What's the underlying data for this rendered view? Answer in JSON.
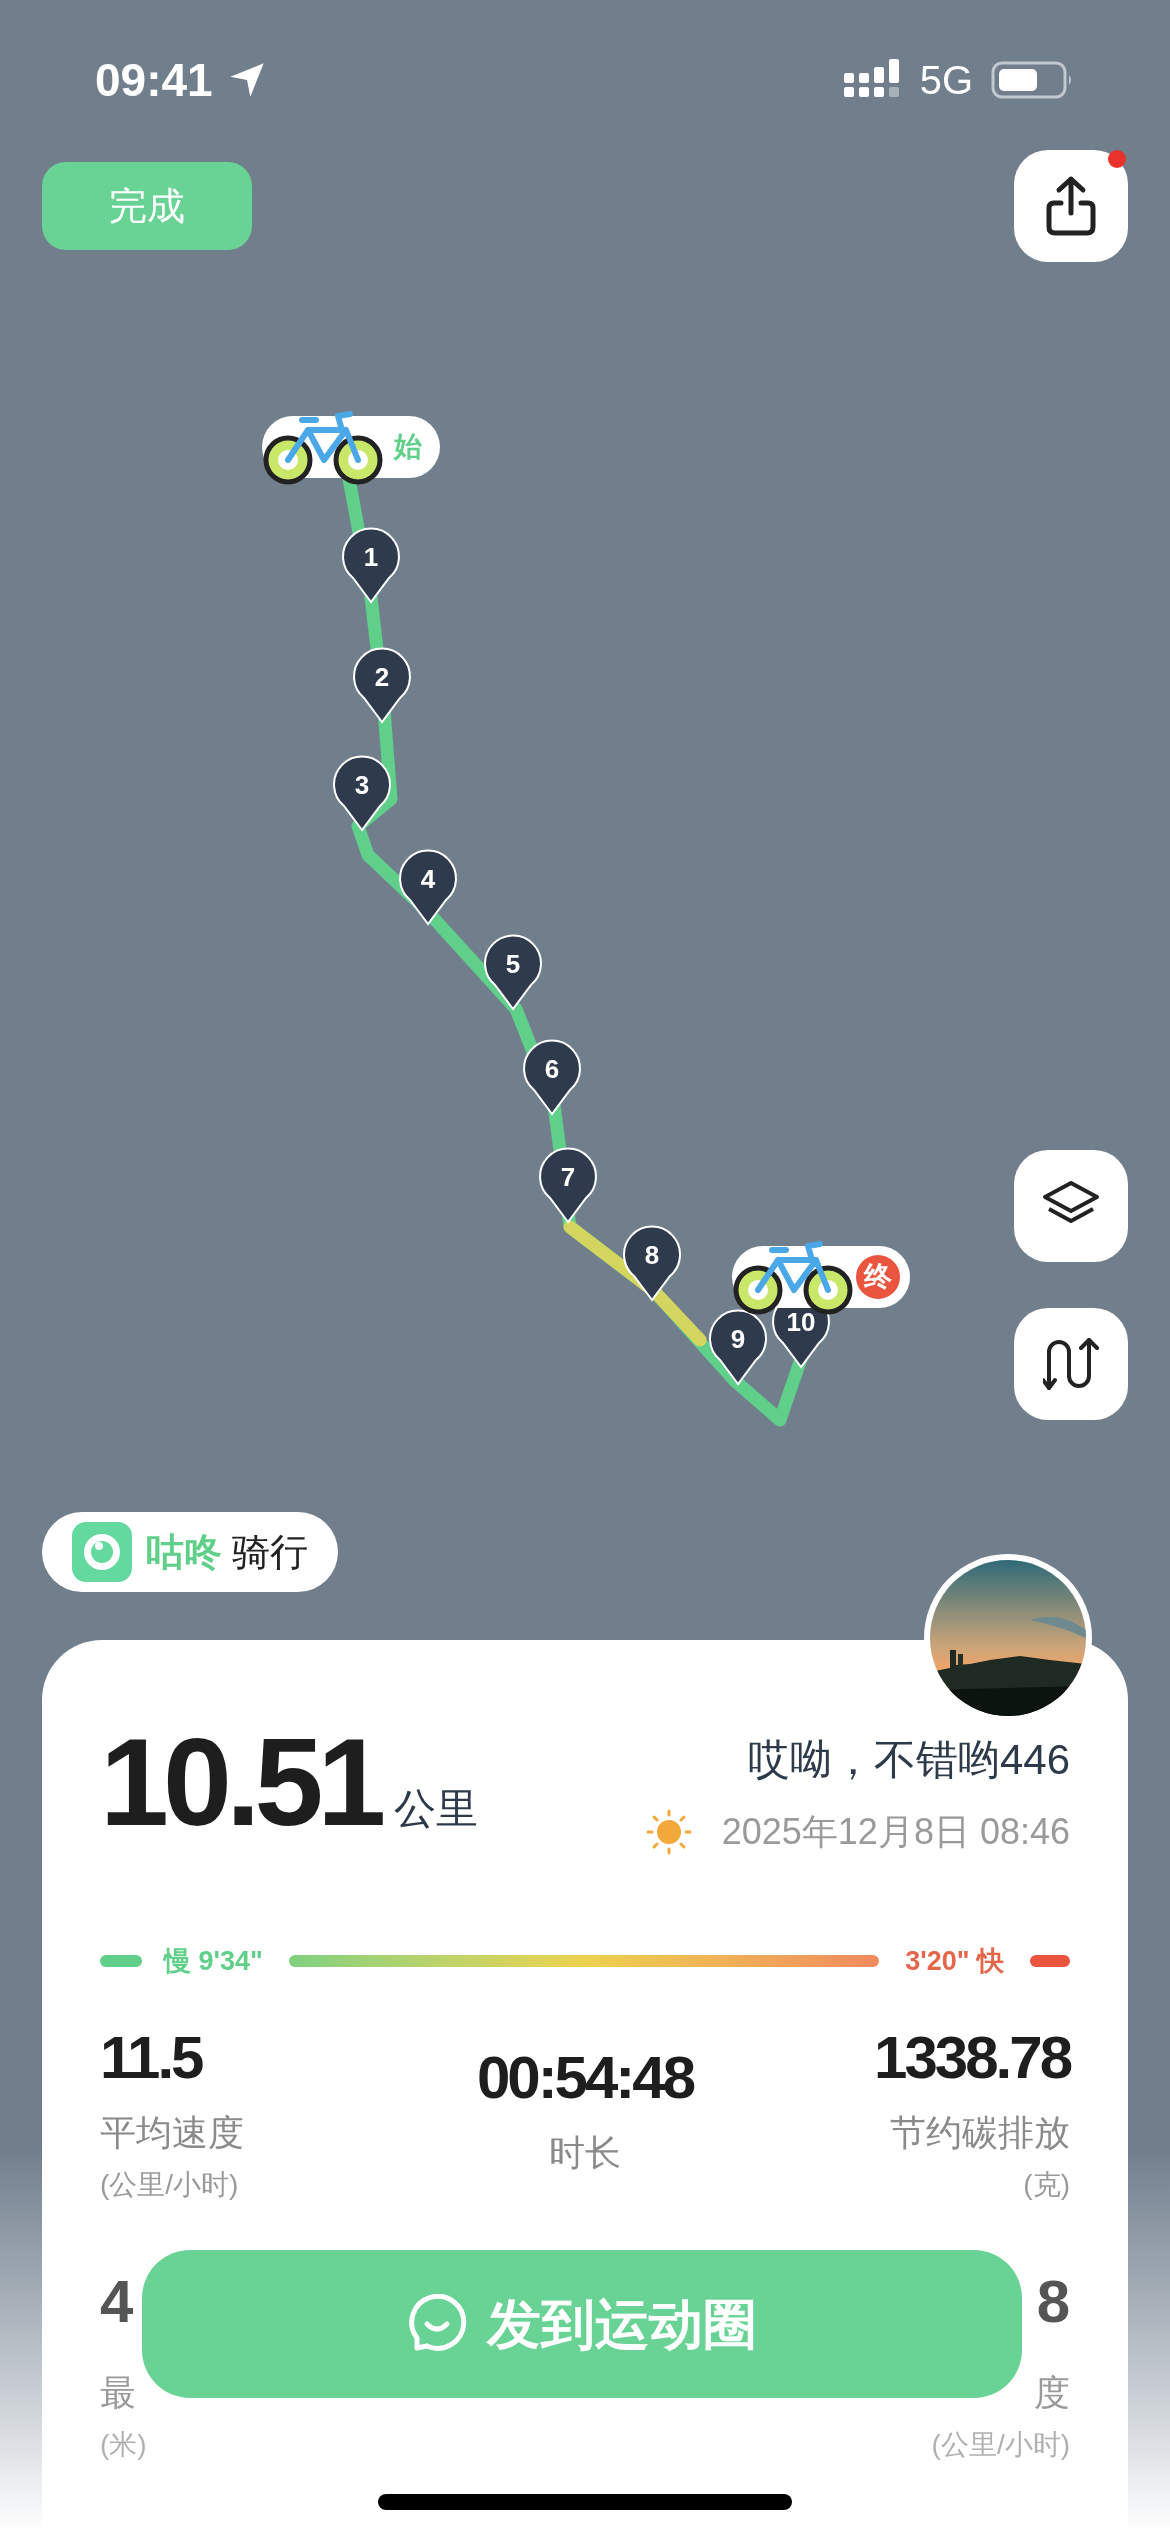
{
  "status_bar": {
    "time": "09:41",
    "network": "5G"
  },
  "done_button": "完成",
  "share_button": {
    "has_badge": true
  },
  "route": {
    "markers": [
      "1",
      "2",
      "3",
      "4",
      "5",
      "6",
      "7",
      "8",
      "9",
      "10"
    ],
    "start_label": "始",
    "end_label": "终"
  },
  "brand": {
    "name": "咕咚",
    "suffix": "骑行"
  },
  "distance": {
    "value": "10.51",
    "unit": "公里"
  },
  "greeting": "哎呦，不错哟446",
  "date": "2025年12月8日 08:46",
  "pace": {
    "slow": "慢 9'34\"",
    "fast": "3'20\" 快"
  },
  "stats": [
    {
      "value": "11.5",
      "label": "平均速度",
      "unit": "(公里/小时)"
    },
    {
      "value": "00:54:48",
      "label": "时长"
    },
    {
      "value": "1338.78",
      "label": "节约碳排放",
      "unit": "(克)"
    }
  ],
  "stats_partial": [
    {
      "value": "4",
      "label": "最",
      "unit": "(米)"
    },
    {
      "value": "8",
      "label": "度",
      "unit": "(公里/小时)"
    }
  ],
  "post_button": "发到运动圈"
}
